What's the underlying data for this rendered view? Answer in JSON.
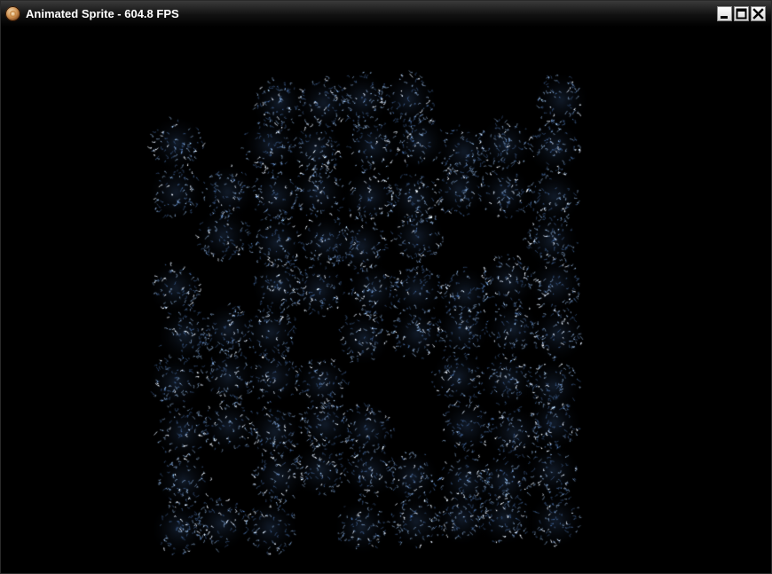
{
  "window": {
    "title": "Animated Sprite - 604.8 FPS",
    "icon": "app-logo-icon",
    "controls": [
      "minimize-icon",
      "maximize-icon",
      "close-icon"
    ]
  },
  "scene": {
    "background_color": "#000000",
    "sprite_color": "#8fb4e0",
    "sprite_highlight": "#e8f2ff"
  }
}
